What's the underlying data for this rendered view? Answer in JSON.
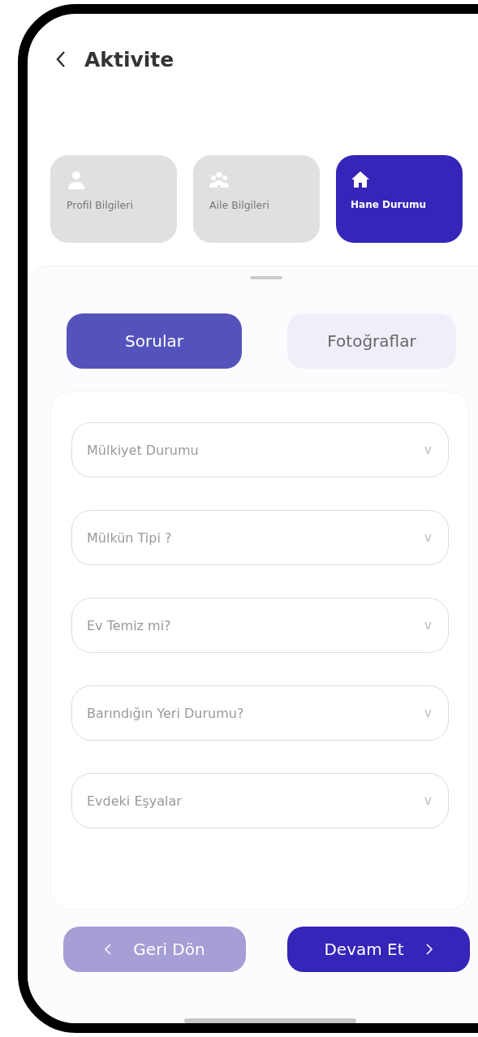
{
  "header": {
    "title": "Aktivite"
  },
  "steps": [
    {
      "kind": "person",
      "label": "Profil Bilgileri",
      "selected": false
    },
    {
      "kind": "group",
      "label": "Aile Bilgileri",
      "selected": false
    },
    {
      "kind": "house",
      "label": "Hane Durumu",
      "selected": true
    }
  ],
  "tabs": [
    {
      "label": "Sorular",
      "selected": true
    },
    {
      "label": "Fotoğraflar",
      "selected": false
    }
  ],
  "fields": [
    {
      "placeholder": "Mülkiyet Durumu",
      "arrow": "v"
    },
    {
      "placeholder": "Mülkün Tipi ?",
      "arrow": "v"
    },
    {
      "placeholder": "Ev Temiz mi?",
      "arrow": "v"
    },
    {
      "placeholder": "Barındığın Yeri Durumu?",
      "arrow": "v"
    },
    {
      "placeholder": "Evdeki Eşyalar",
      "arrow": "v"
    }
  ],
  "buttons": [
    {
      "kind": "back",
      "label": "Geri Dön",
      "disabled": true
    },
    {
      "kind": "next",
      "label": "Devam Et",
      "disabled": false
    }
  ]
}
